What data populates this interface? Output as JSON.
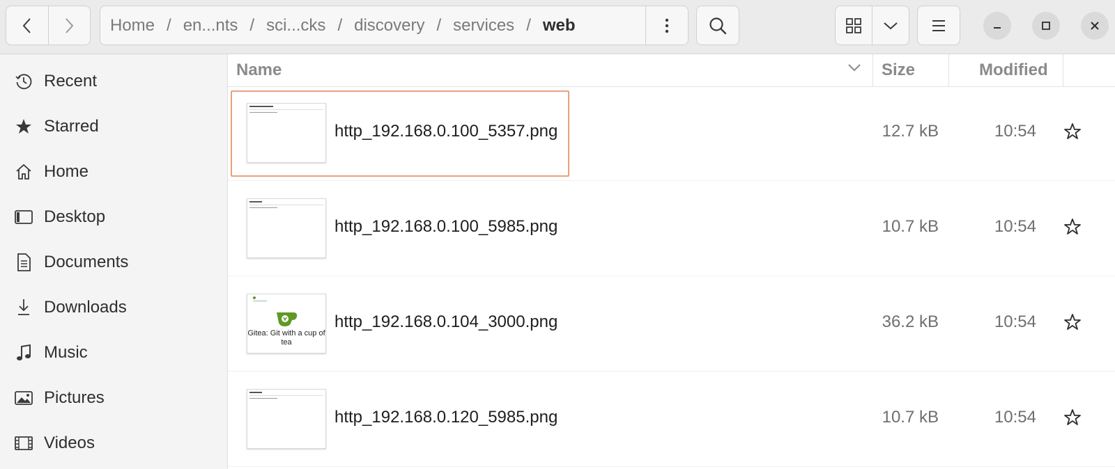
{
  "header": {
    "breadcrumbs": [
      "Home",
      "en...nts",
      "sci...cks",
      "discovery",
      "services",
      "web"
    ],
    "separator": "/"
  },
  "sidebar": {
    "items": [
      {
        "label": "Recent",
        "icon": "clock-icon"
      },
      {
        "label": "Starred",
        "icon": "star-filled-icon"
      },
      {
        "label": "Home",
        "icon": "home-icon"
      },
      {
        "label": "Desktop",
        "icon": "desktop-icon"
      },
      {
        "label": "Documents",
        "icon": "document-icon"
      },
      {
        "label": "Downloads",
        "icon": "download-icon"
      },
      {
        "label": "Music",
        "icon": "music-icon"
      },
      {
        "label": "Pictures",
        "icon": "picture-icon"
      },
      {
        "label": "Videos",
        "icon": "video-icon"
      }
    ]
  },
  "list": {
    "columns": {
      "name": "Name",
      "size": "Size",
      "modified": "Modified"
    },
    "files": [
      {
        "name": "http_192.168.0.100_5357.png",
        "size": "12.7 kB",
        "modified": "10:54",
        "selected": true
      },
      {
        "name": "http_192.168.0.100_5985.png",
        "size": "10.7 kB",
        "modified": "10:54",
        "selected": false
      },
      {
        "name": "http_192.168.0.104_3000.png",
        "size": "36.2 kB",
        "modified": "10:54",
        "selected": false,
        "thumb_text": "Gitea: Git with a cup of tea"
      },
      {
        "name": "http_192.168.0.120_5985.png",
        "size": "10.7 kB",
        "modified": "10:54",
        "selected": false
      }
    ]
  },
  "colors": {
    "selection_border": "#e8a07f",
    "gitea_green": "#609926"
  }
}
